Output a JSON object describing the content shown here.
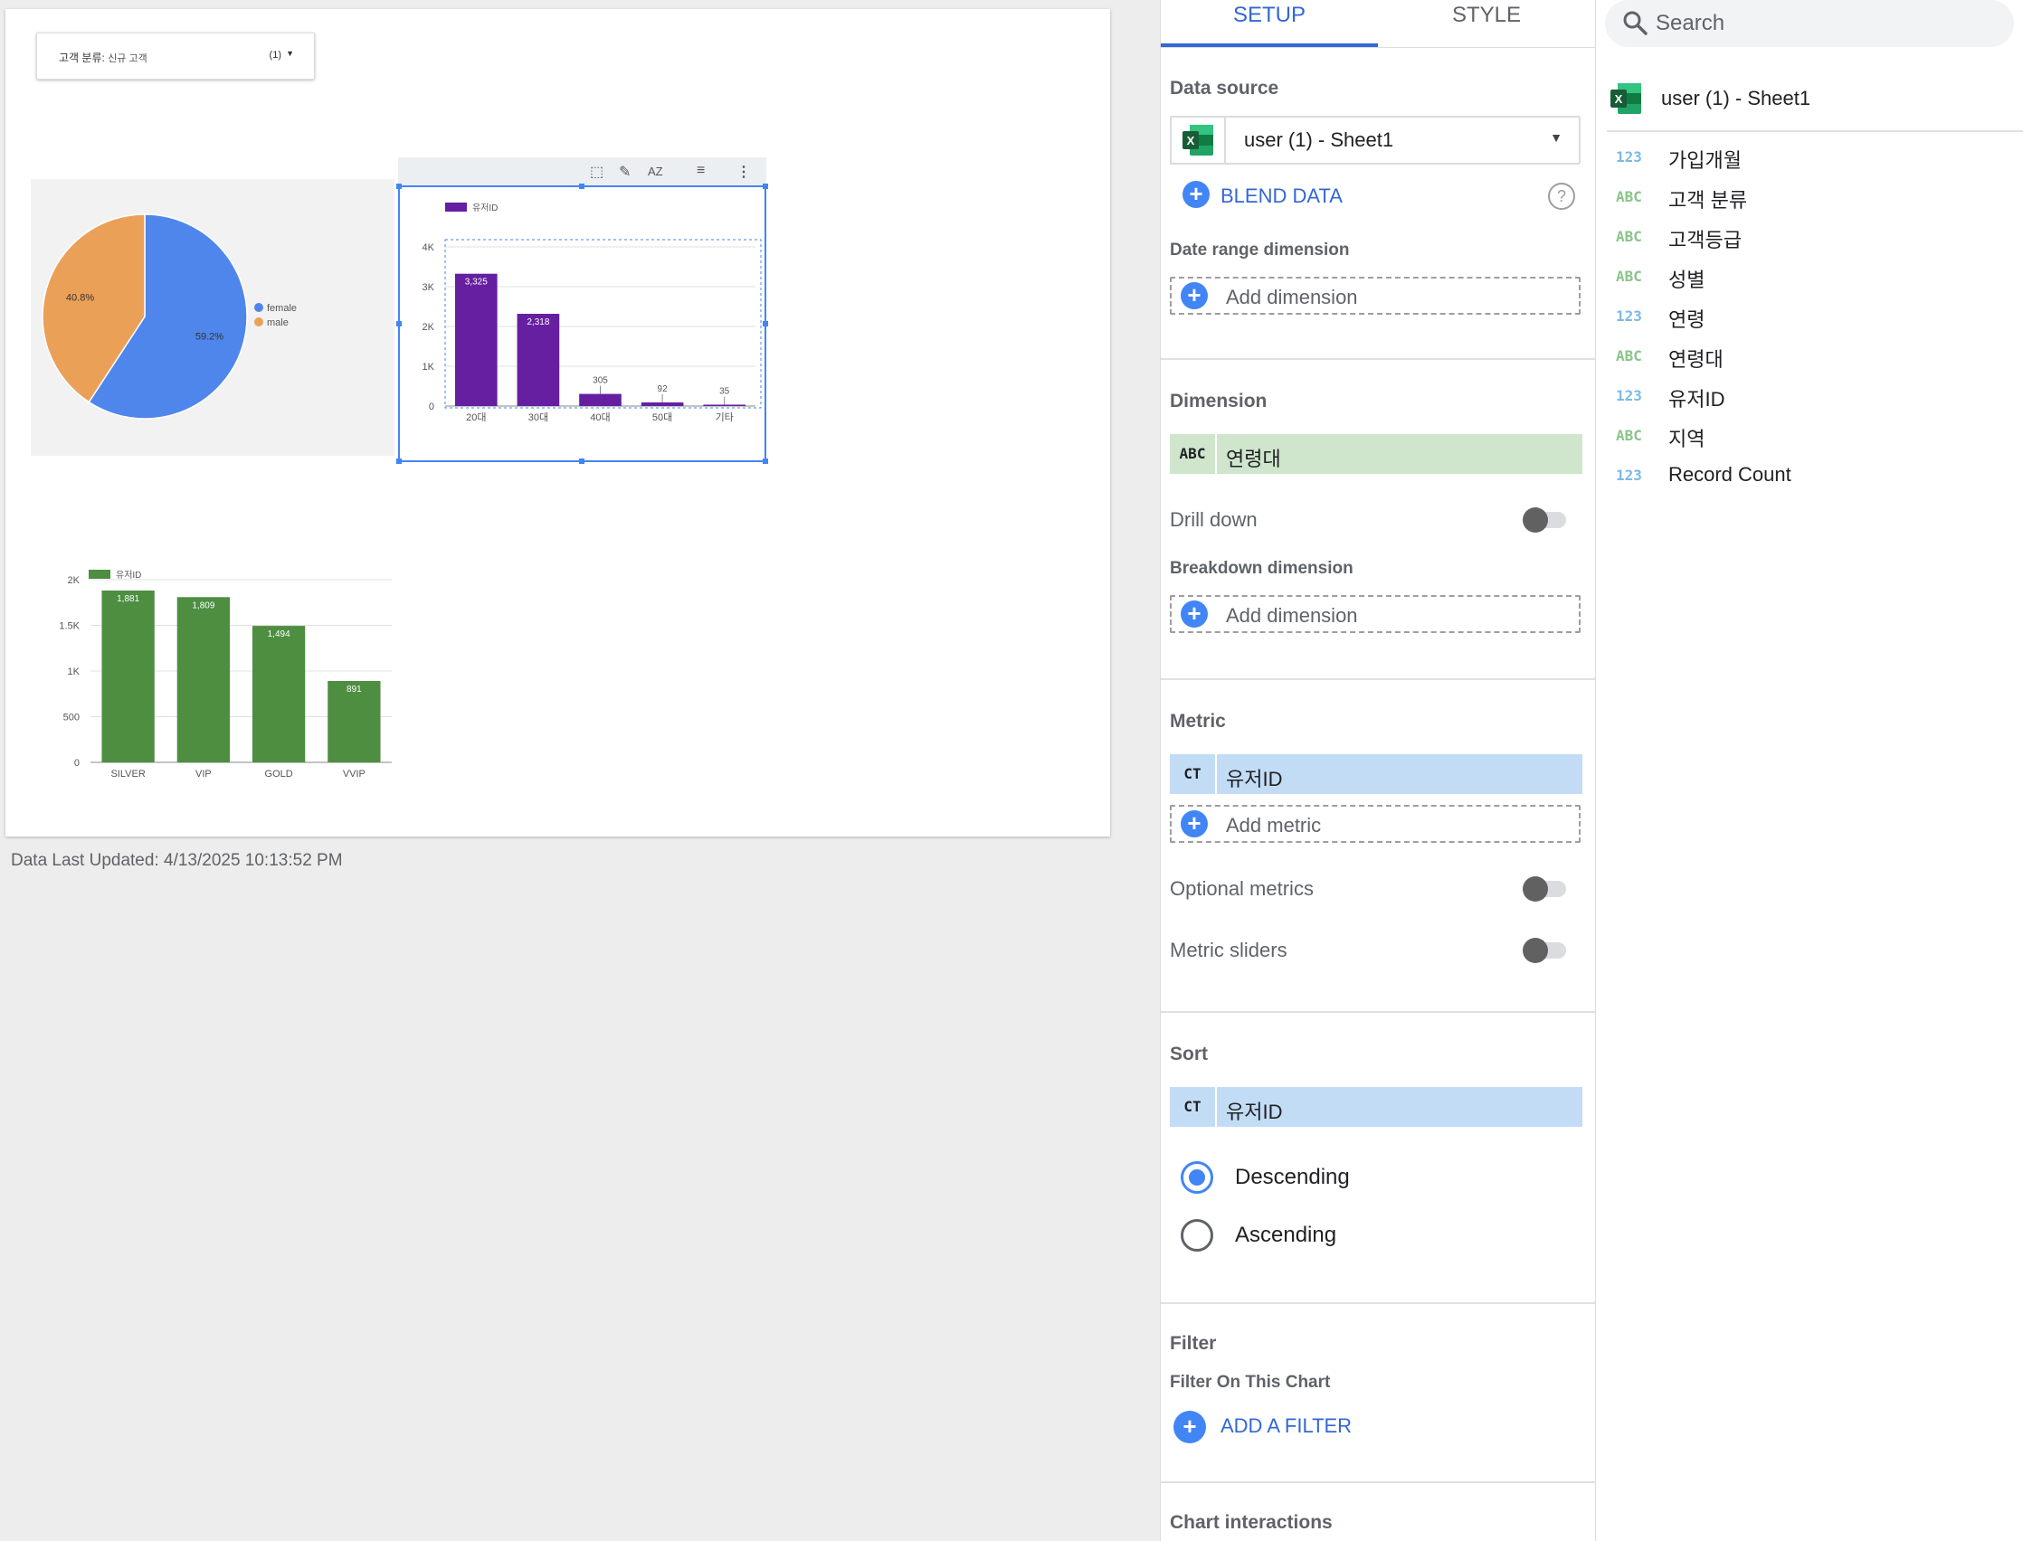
{
  "report": {
    "filter_control": {
      "label": "고객 분류:",
      "value": "신규 고객",
      "count": "(1)"
    },
    "last_updated": "Data Last Updated: 4/13/2025 10:13:52 PM"
  },
  "chart_data": [
    {
      "type": "pie",
      "categories": [
        "female",
        "male"
      ],
      "values": [
        59.2,
        40.8
      ],
      "labels": [
        "59.2%",
        "40.8%"
      ],
      "colors": [
        "#4f86ec",
        "#eba058"
      ],
      "legend_position": "right"
    },
    {
      "type": "bar",
      "series": [
        {
          "name": "유저ID",
          "values": [
            3325,
            2318,
            305,
            92,
            35
          ]
        }
      ],
      "categories": [
        "20대",
        "30대",
        "40대",
        "50대",
        "기타"
      ],
      "value_labels": [
        "3,325",
        "2,318",
        "305",
        "92",
        "35"
      ],
      "yticks": [
        "0",
        "1K",
        "2K",
        "3K",
        "4K"
      ],
      "ylim": [
        0,
        4000
      ],
      "color": "#651fa0",
      "grid": true,
      "legend_position": "top-left"
    },
    {
      "type": "bar",
      "series": [
        {
          "name": "유저ID",
          "values": [
            1881,
            1809,
            1494,
            891
          ]
        }
      ],
      "categories": [
        "SILVER",
        "VIP",
        "GOLD",
        "VVIP"
      ],
      "value_labels": [
        "1,881",
        "1,809",
        "1,494",
        "891"
      ],
      "yticks": [
        "0",
        "500",
        "1K",
        "1.5K",
        "2K"
      ],
      "ylim": [
        0,
        2000
      ],
      "color": "#4d8e40",
      "grid": true,
      "legend_position": "top-left"
    }
  ],
  "setup": {
    "tabs": {
      "setup": "SETUP",
      "style": "STYLE"
    },
    "data_source": {
      "title": "Data source",
      "value": "user (1) - Sheet1",
      "blend": "BLEND DATA"
    },
    "date_range": {
      "title": "Date range dimension",
      "add": "Add dimension"
    },
    "dimension": {
      "title": "Dimension",
      "type": "ABC",
      "field": "연령대",
      "drill_down": "Drill down"
    },
    "breakdown": {
      "title": "Breakdown dimension",
      "add": "Add dimension"
    },
    "metric": {
      "title": "Metric",
      "type": "CT",
      "field": "유저ID",
      "add": "Add metric",
      "optional": "Optional metrics",
      "sliders": "Metric sliders"
    },
    "sort": {
      "title": "Sort",
      "type": "CT",
      "field": "유저ID",
      "descending": "Descending",
      "ascending": "Ascending"
    },
    "filter": {
      "title": "Filter",
      "subtitle": "Filter On This Chart",
      "add": "ADD A FILTER"
    },
    "interactions": {
      "title": "Chart interactions"
    }
  },
  "data_panel": {
    "search_placeholder": "Search",
    "source": "user (1) - Sheet1",
    "fields": [
      {
        "type": "123",
        "name": "가입개월"
      },
      {
        "type": "ABC",
        "name": "고객 분류"
      },
      {
        "type": "ABC",
        "name": "고객등급"
      },
      {
        "type": "ABC",
        "name": "성별"
      },
      {
        "type": "123",
        "name": "연령"
      },
      {
        "type": "ABC",
        "name": "연령대"
      },
      {
        "type": "123",
        "name": "유저ID"
      },
      {
        "type": "ABC",
        "name": "지역"
      },
      {
        "type": "123",
        "name": "Record Count"
      }
    ]
  }
}
